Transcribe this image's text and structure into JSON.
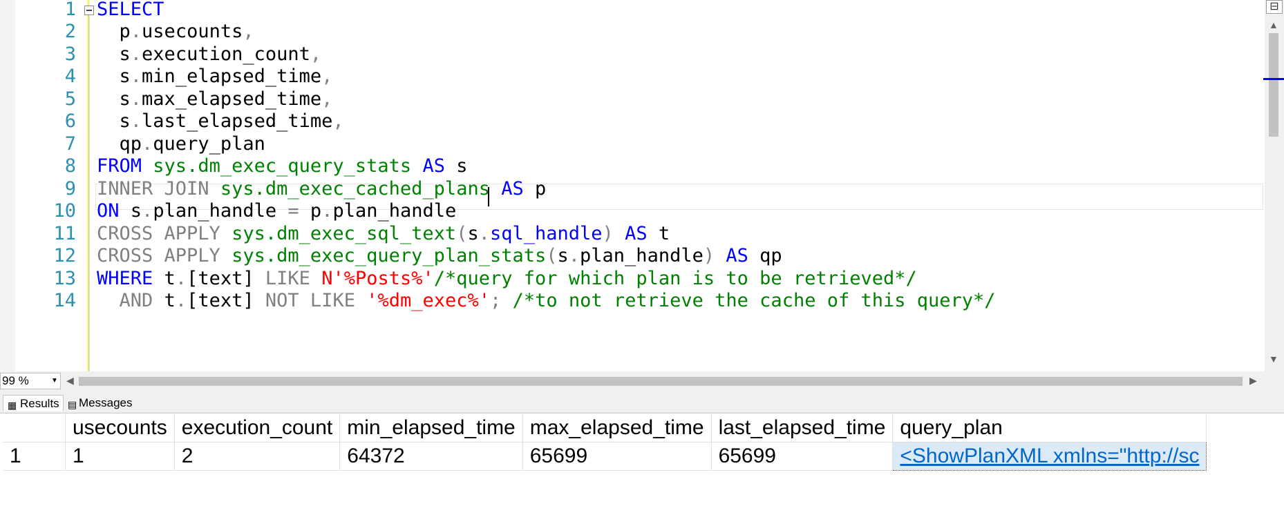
{
  "editor": {
    "line_numbers": [
      "1",
      "2",
      "3",
      "4",
      "5",
      "6",
      "7",
      "8",
      "9",
      "10",
      "11",
      "12",
      "13",
      "14"
    ],
    "line1": {
      "select": "SELECT"
    },
    "line2": {
      "alias": "p",
      "dot": ".",
      "col": "usecounts",
      "comma": ","
    },
    "line3": {
      "alias": "s",
      "dot": ".",
      "col": "execution_count",
      "comma": ","
    },
    "line4": {
      "alias": "s",
      "dot": ".",
      "col": "min_elapsed_time",
      "comma": ","
    },
    "line5": {
      "alias": "s",
      "dot": ".",
      "col": "max_elapsed_time",
      "comma": ","
    },
    "line6": {
      "alias": "s",
      "dot": ".",
      "col": "last_elapsed_time",
      "comma": ","
    },
    "line7": {
      "alias": "qp",
      "dot": ".",
      "col": "query_plan"
    },
    "line8": {
      "from": "FROM",
      "obj": "sys.dm_exec_query_stats",
      "as": "AS",
      "alias": "s"
    },
    "line9": {
      "join": "INNER JOIN",
      "obj": "sys.dm_exec_cached_plans",
      "as": "AS",
      "alias": "p"
    },
    "line10": {
      "on": "ON",
      "a": "s",
      "dot1": ".",
      "col1": "plan_handle",
      "eq": "=",
      "b": "p",
      "dot2": ".",
      "col2": "plan_handle"
    },
    "line11": {
      "apply": "CROSS APPLY",
      "fn": "sys.dm_exec_sql_text",
      "lp": "(",
      "a": "s",
      "dot": ".",
      "col": "sql_handle",
      "rp": ")",
      "as": "AS",
      "alias": "t"
    },
    "line12": {
      "apply": "CROSS APPLY",
      "fn": "sys.dm_exec_query_plan_stats",
      "lp": "(",
      "a": "s",
      "dot": ".",
      "col": "plan_handle",
      "rp": ")",
      "as": "AS",
      "alias": "qp"
    },
    "line13": {
      "where": "WHERE",
      "a": "t",
      "dot": ".",
      "col": "[text]",
      "like": "LIKE",
      "str": "N'%Posts%'",
      "comment": "/*query for which plan is to be retrieved*/"
    },
    "line14": {
      "and": "AND",
      "a": "t",
      "dot": ".",
      "col": "[text]",
      "notlike": "NOT LIKE",
      "str": "'%dm_exec%'",
      "semi": ";",
      "comment": "/*to not retrieve the cache of this query*/"
    }
  },
  "zoom": {
    "value": "99 %"
  },
  "tabs": {
    "results": "Results",
    "messages": "Messages"
  },
  "grid": {
    "columns": [
      "usecounts",
      "execution_count",
      "min_elapsed_time",
      "max_elapsed_time",
      "last_elapsed_time",
      "query_plan"
    ],
    "rows": [
      {
        "num": "1",
        "usecounts": "1",
        "execution_count": "2",
        "min_elapsed_time": "64372",
        "max_elapsed_time": "65699",
        "last_elapsed_time": "65699",
        "query_plan": "<ShowPlanXML xmlns=\"http://sc"
      }
    ]
  },
  "colors": {
    "keyword": "#0000ff",
    "function": "#008000",
    "string": "#ff0000",
    "comment": "#008000",
    "gray_keyword": "#808080",
    "line_number": "#2b91af",
    "link": "#0066cc"
  }
}
